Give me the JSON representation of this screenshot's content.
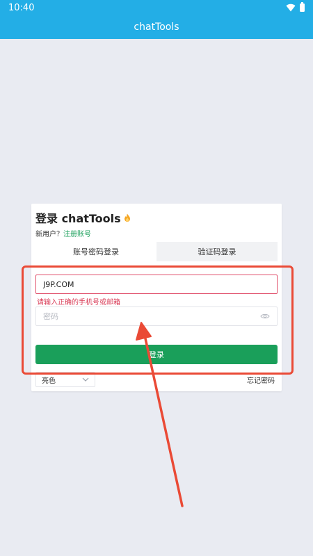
{
  "status_bar": {
    "time": "10:40"
  },
  "app_bar": {
    "title": "chatTools"
  },
  "login": {
    "title": "登录 chatTools",
    "new_user_prefix": "新用户？",
    "register_link": "注册账号",
    "tabs": [
      {
        "label": "账号密码登录",
        "active": true
      },
      {
        "label": "验证码登录",
        "active": false
      }
    ],
    "account_value": "J9P.COM",
    "account_error": "请输入正确的手机号或邮箱",
    "password_placeholder": "密码",
    "submit_label": "登录",
    "theme_value": "亮色",
    "forgot_password": "忘记密码"
  },
  "colors": {
    "accent_blue": "#23aee6",
    "primary_green": "#1a9f5a",
    "error_red": "#d93a55",
    "annotation_red": "#ea4a36"
  },
  "icons": {
    "status": [
      "wifi-icon",
      "battery-icon"
    ],
    "title_badge": "flame-icon",
    "password_toggle": "eye-icon",
    "select": "chevron-down-icon"
  }
}
